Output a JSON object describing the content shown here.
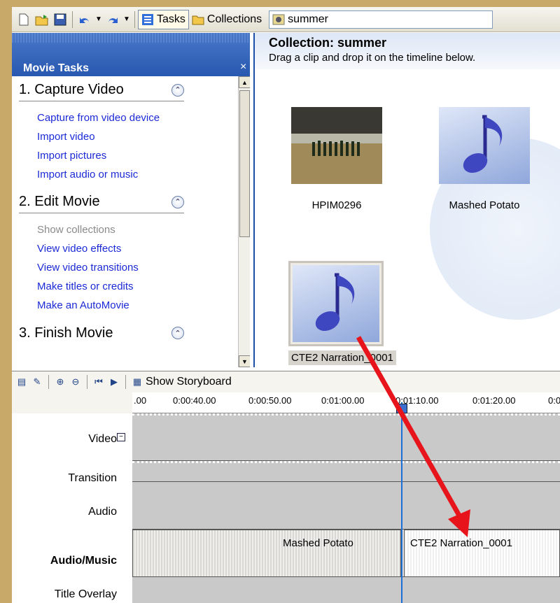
{
  "toolbar": {
    "tasks_label": "Tasks",
    "collections_label": "Collections",
    "collection_combo_value": "summer"
  },
  "tasks_pane": {
    "title": "Movie Tasks",
    "close": "×",
    "sections": [
      {
        "heading": "1. Capture Video",
        "links": [
          "Capture from video device",
          "Import video",
          "Import pictures",
          "Import audio or music"
        ]
      },
      {
        "heading": "2. Edit Movie",
        "links": [
          "Show collections",
          "View video effects",
          "View video transitions",
          "Make titles or credits",
          "Make an AutoMovie"
        ]
      },
      {
        "heading": "3. Finish Movie",
        "links": []
      }
    ]
  },
  "collection": {
    "title": "Collection: summer",
    "subtitle": "Drag a clip and drop it on the timeline below.",
    "clips": [
      "HPIM0296",
      "Mashed Potato",
      "CTE2 Narration_0001"
    ]
  },
  "timeline": {
    "show_storyboard_label": "Show Storyboard",
    "ruler_ticks": [
      ".00",
      "0:00:40.00",
      "0:00:50.00",
      "0:01:00.00",
      "0:01:10.00",
      "0:01:20.00",
      "0:0"
    ],
    "track_labels": {
      "video": "Video",
      "transition": "Transition",
      "audio": "Audio",
      "audio_music": "Audio/Music",
      "title_overlay": "Title Overlay"
    },
    "audio_music_clips": [
      "Mashed Potato",
      "CTE2 Narration_0001"
    ]
  },
  "colors": {
    "annotation_arrow": "#e8141c",
    "playhead": "#1e6fd8",
    "link": "#1c2ad6",
    "tasks_header": "#2858b0"
  }
}
